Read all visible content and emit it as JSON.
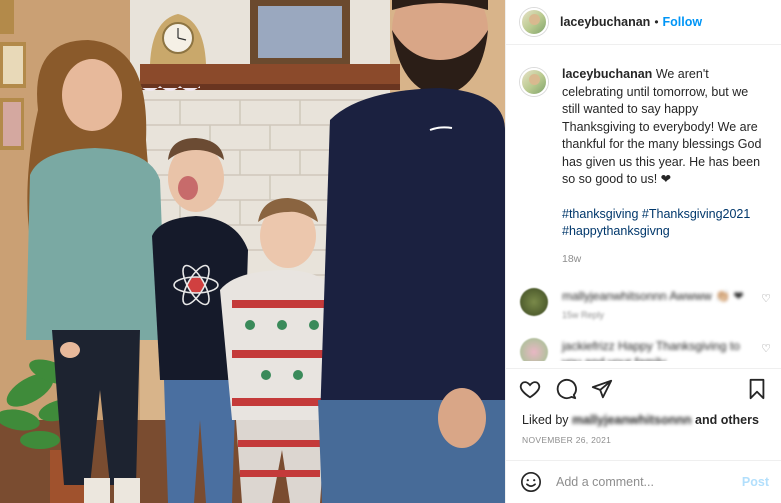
{
  "post": {
    "author": "laceybuchanan",
    "dot": "•",
    "follow_label": "Follow",
    "caption": "We aren't celebrating until tomorrow, but we still wanted to say happy Thanksgiving to everybody! We are thankful for the many blessings God has given us this year. He has been so so good to us! ❤",
    "hashtags": "#thanksgiving #Thanksgiving2021 #happythanksgivng",
    "age": "18w"
  },
  "comments": [
    {
      "text": "mallyjeanwhitsonnn Awwww 👏🏼 ❤",
      "meta": "15w   Reply"
    },
    {
      "text": "jackiefrizz Happy Thanksgiving to you and your family",
      "meta": ""
    }
  ],
  "actions": {
    "like_icon": "heart-icon",
    "comment_icon": "comment-icon",
    "share_icon": "share-icon",
    "save_icon": "bookmark-icon"
  },
  "likes": {
    "prefix": "Liked by",
    "name": "mallyjeanwhitsonnn",
    "suffix": "and others"
  },
  "date": "NOVEMBER 26, 2021",
  "add_comment": {
    "placeholder": "Add a comment...",
    "post_label": "Post",
    "emoji_icon": "emoji-icon"
  },
  "colors": {
    "accent": "#0095f6",
    "link": "#00376b",
    "muted": "#8e8e8e",
    "post_disabled": "#b2dffc"
  }
}
